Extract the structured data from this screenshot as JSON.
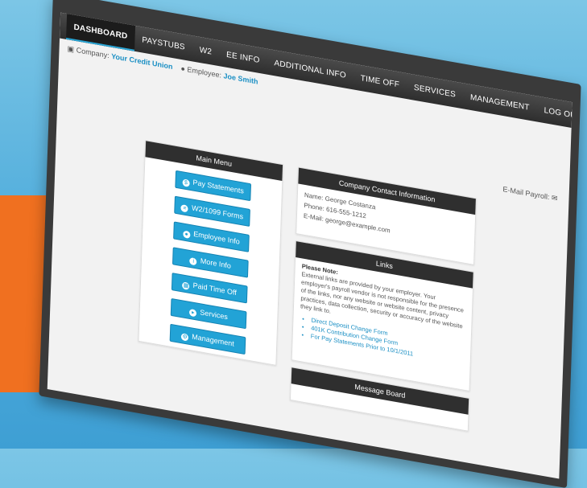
{
  "side_fragments": [
    "f",
    "e"
  ],
  "nav": {
    "items": [
      "DASHBOARD",
      "PAYSTUBS",
      "W2",
      "EE INFO",
      "ADDITIONAL INFO",
      "TIME OFF",
      "SERVICES",
      "MANAGEMENT",
      "LOG OUT"
    ]
  },
  "info": {
    "company_label": "Company:",
    "company_value": "Your Credit Union",
    "employee_label": "Employee:",
    "employee_value": "Joe Smith"
  },
  "email_payroll": "E-Mail Payroll:",
  "main_menu": {
    "title": "Main Menu",
    "buttons": [
      "Pay Statements",
      "W2/1099 Forms",
      "Employee Info",
      "More Info",
      "Paid Time Off",
      "Services",
      "Management"
    ]
  },
  "contact": {
    "title": "Company Contact Information",
    "name_label": "Name:",
    "name": "George Costanza",
    "phone_label": "Phone:",
    "phone": "616-555-1212",
    "email_label": "E-Mail:",
    "email": "george@example.com"
  },
  "links": {
    "title": "Links",
    "note_title": "Please Note:",
    "note_text": "External links are provided by your employer. Your employer's payroll vendor is not responsible for the presence of the links, nor any website or website content, privacy practices, data collection, security or accuracy of the website they link to.",
    "items": [
      "Direct Deposit Change Form",
      "401K Contribution Change Form",
      "For Pay Statements Prior to 10/1/2011"
    ]
  },
  "message_board": {
    "title": "Message Board"
  }
}
